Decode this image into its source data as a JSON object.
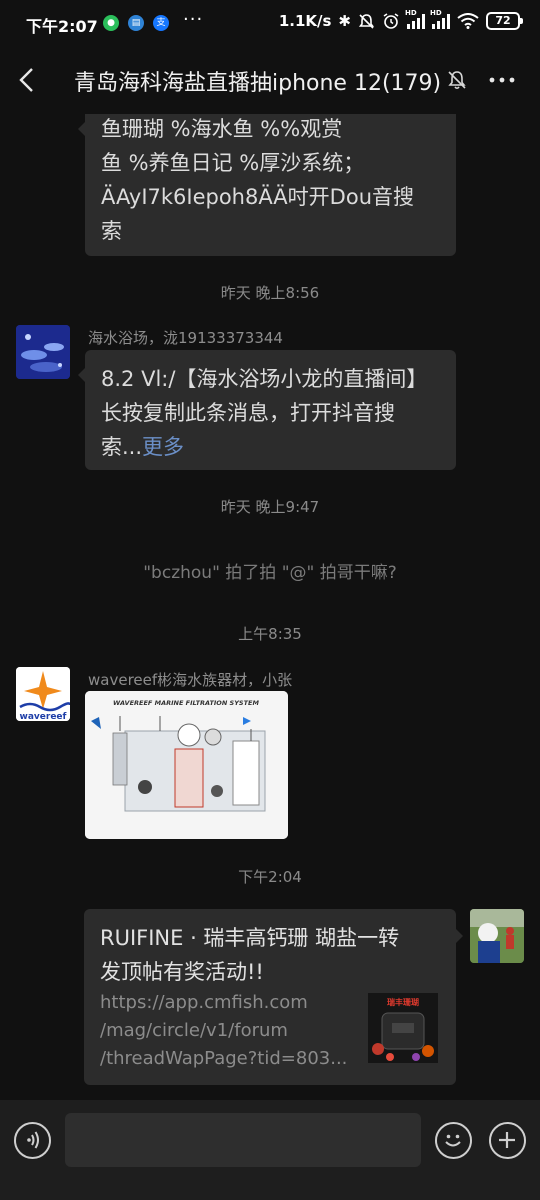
{
  "status_bar": {
    "time": "下午2:07",
    "dots": "···",
    "network_speed": "1.1K/s",
    "battery": "72"
  },
  "header": {
    "title": "青岛海科海盐直播抽iphone 12(179)"
  },
  "messages": [
    {
      "type": "text",
      "lines": [
        "鱼珊瑚 %海水鱼 %%观赏",
        "鱼 %养鱼日记 %厚沙系统；",
        "ÄAyI7k6Iepoh8ÄÄ吋开Dou音搜",
        "索"
      ]
    },
    {
      "type": "timestamp",
      "text": "昨天 晚上8:56"
    },
    {
      "type": "text",
      "sender": "海水浴场，泷19133373344",
      "lines": [
        "8.2 Vl:/【海水浴场小龙的直播间】",
        "长按复制此条消息，打开抖音搜"
      ],
      "last_line": "索...",
      "more_label": "更多"
    },
    {
      "type": "timestamp",
      "text": "昨天 晚上9:47"
    },
    {
      "type": "system",
      "text": "\"bczhou\" 拍了拍 \"@\" 拍哥干嘛?"
    },
    {
      "type": "timestamp",
      "text": "上午8:35"
    },
    {
      "type": "image",
      "sender": "wavereef彬海水族器材，小张",
      "avatar_text": "wavereef",
      "image_caption": "WAVEREEF MARINE FILTRATION SYSTEM"
    },
    {
      "type": "timestamp",
      "text": "下午2:04"
    },
    {
      "type": "link",
      "title_lines": [
        "RUIFINE · 瑞丰高钙珊 瑚盐一转",
        "发顶帖有奖活动!!"
      ],
      "url_lines": [
        "https://app.cmfish.com",
        "/mag/circle/v1/forum",
        "/threadWapPage?tid=803..."
      ],
      "thumb_text": "瑞丰珊瑚"
    }
  ],
  "colors": {
    "background": "#111111",
    "bubble": "#2c2c2c",
    "link": "#6b8fc7",
    "input_bar": "#1e1e1e"
  },
  "icons": [
    "wechat-icon",
    "message-icon",
    "alipay-icon",
    "bluetooth-icon",
    "silent-icon",
    "alarm-icon",
    "signal-icon",
    "wifi-icon",
    "back-icon",
    "mute-icon",
    "more-icon",
    "voice-icon",
    "emoji-icon",
    "plus-icon"
  ]
}
